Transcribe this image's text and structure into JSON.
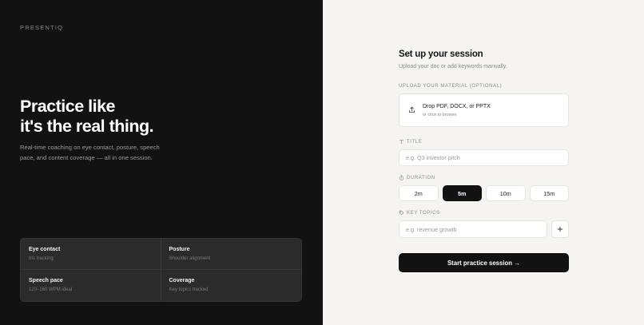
{
  "brand": "PRESENTIQ",
  "hero": {
    "title_line1": "Practice like",
    "title_line2": "it's the real thing.",
    "subtitle": "Real-time coaching on eye contact, posture, speech pace, and content coverage — all in one session."
  },
  "features": [
    {
      "title": "Eye contact",
      "desc": "Iris tracking"
    },
    {
      "title": "Posture",
      "desc": "Shoulder alignment"
    },
    {
      "title": "Speech pace",
      "desc": "120–160 WPM ideal"
    },
    {
      "title": "Coverage",
      "desc": "Key topics tracked"
    }
  ],
  "form": {
    "title": "Set up your session",
    "subtitle": "Upload your doc or add keywords manually.",
    "upload_label": "UPLOAD YOUR MATERIAL (OPTIONAL)",
    "dropzone_main": "Drop PDF, DOCX, or PPTX",
    "dropzone_hint": "or click to browse",
    "title_label": "TITLE",
    "title_placeholder": "e.g. Q3 investor pitch",
    "duration_label": "DURATION",
    "durations": [
      "2m",
      "5m",
      "10m",
      "15m"
    ],
    "selected_duration": "5m",
    "topics_label": "KEY TOPICS",
    "topics_placeholder": "e.g. revenue growth",
    "start_label": "Start practice session →"
  },
  "icons": {
    "upload": "upload-icon",
    "title": "text-icon",
    "duration": "timer-icon",
    "topics": "tag-icon",
    "add": "plus-icon"
  },
  "colors": {
    "dark_panel": "#121212",
    "light_panel": "#f5f4f1",
    "accent": "#121212"
  }
}
